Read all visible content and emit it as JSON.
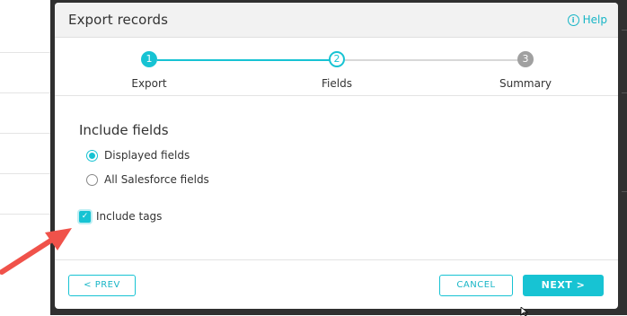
{
  "dialog": {
    "title": "Export records",
    "help_label": "Help",
    "help_icon": "info-icon"
  },
  "stepper": {
    "steps": [
      {
        "number": "1",
        "label": "Export",
        "state": "done"
      },
      {
        "number": "2",
        "label": "Fields",
        "state": "current"
      },
      {
        "number": "3",
        "label": "Summary",
        "state": "todo"
      }
    ]
  },
  "fields": {
    "section_title": "Include fields",
    "options": [
      {
        "label": "Displayed fields",
        "selected": true
      },
      {
        "label": "All Salesforce fields",
        "selected": false
      }
    ],
    "include_tags": {
      "label": "Include tags",
      "checked": true
    }
  },
  "footer": {
    "prev_label": "< PREV",
    "cancel_label": "CANCEL",
    "next_label": "NEXT >"
  },
  "colors": {
    "accent": "#17c3d3",
    "arrow": "#f0524a"
  }
}
